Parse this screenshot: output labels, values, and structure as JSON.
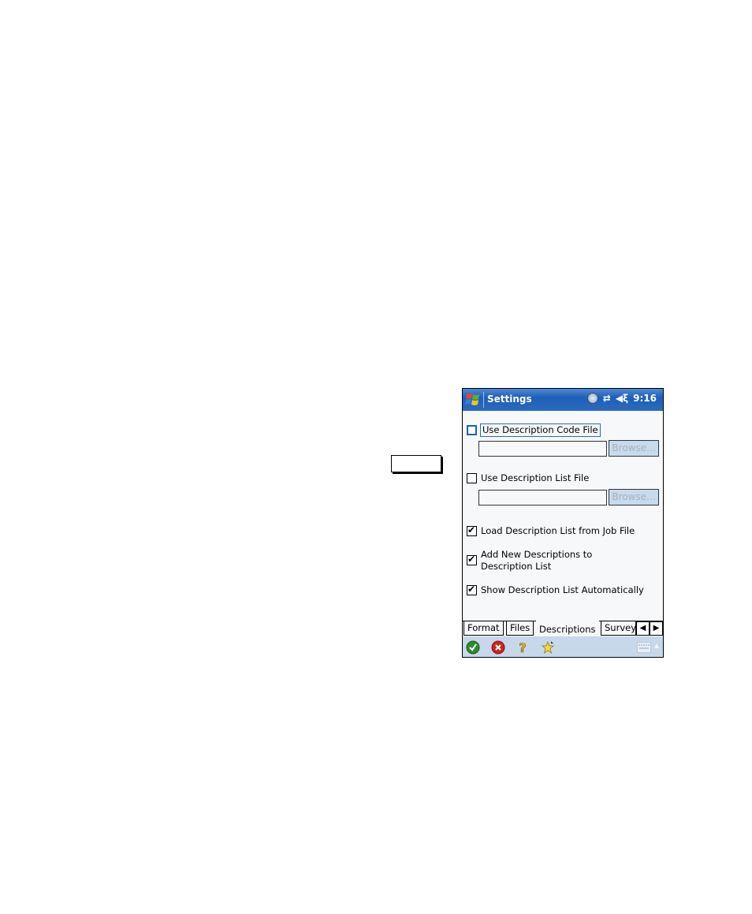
{
  "titlebar": {
    "title": "Settings",
    "time": "9:16",
    "icons": [
      "windows-start-icon",
      "connectivity-icon",
      "sync-arrows-icon",
      "speaker-muted-icon"
    ]
  },
  "options": {
    "use_code_file": {
      "label": "Use Description Code File",
      "checked": false,
      "focused": true
    },
    "code_file_path": {
      "value": "",
      "placeholder": ""
    },
    "code_browse": {
      "label": "Browse...",
      "enabled": false
    },
    "use_list_file": {
      "label": "Use Description List File",
      "checked": false
    },
    "list_file_path": {
      "value": "",
      "placeholder": ""
    },
    "list_browse": {
      "label": "Browse...",
      "enabled": false
    },
    "load_from_job": {
      "label": "Load Description List from Job File",
      "checked": true
    },
    "add_new_line1": "Add New Descriptions to",
    "add_new_line2": "Description List",
    "add_new_checked": true,
    "show_auto": {
      "label": "Show Description List Automatically",
      "checked": true
    }
  },
  "tabs": [
    {
      "label": "Format"
    },
    {
      "label": "Files"
    },
    {
      "label": "Descriptions",
      "active": true
    },
    {
      "label": "Survey"
    }
  ],
  "tab_scroll": {
    "left": "◀",
    "right": "▶"
  },
  "cmdbar": {
    "ok": "ok-icon",
    "cancel": "cancel-icon",
    "help": "help-icon",
    "favorites": "favorites-icon",
    "keyboard": "keyboard-icon"
  }
}
